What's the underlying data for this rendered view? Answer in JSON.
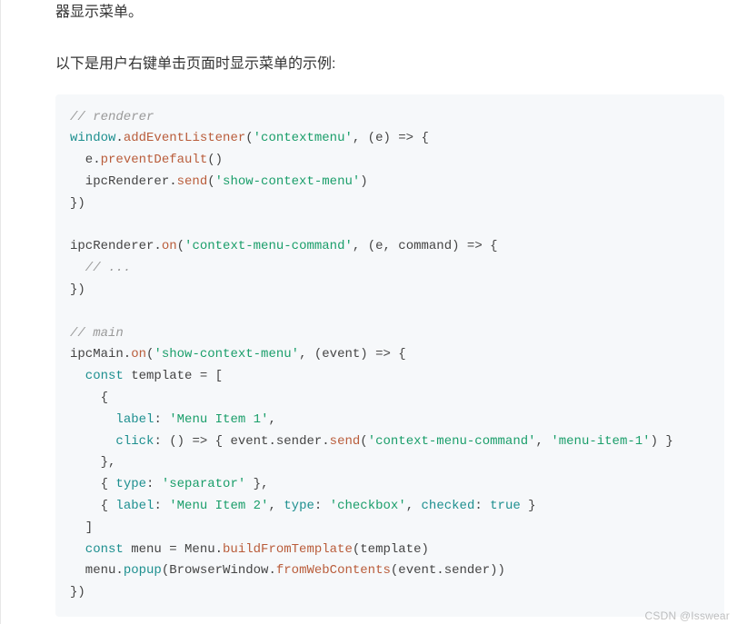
{
  "paragraphs": {
    "line1": "器显示菜单。",
    "line2": "以下是用户右键单击页面时显示菜单的示例:"
  },
  "code": {
    "c_renderer": "// renderer",
    "window": "window",
    "addEventListener": "addEventListener",
    "str_contextmenu": "'contextmenu'",
    "arrow_e": ", (e) => {",
    "e_dot": "  e.",
    "preventDefault": "preventDefault",
    "call_close": "()",
    "ipcRenderer_send_pre": "  ipcRenderer.",
    "send": "send",
    "str_show_menu": "'show-context-menu'",
    "rparen": ")",
    "brace_close_paren": "})",
    "ipcRenderer_on_pre": "ipcRenderer.",
    "on": "on",
    "str_ctx_cmd": "'context-menu-command'",
    "arrow_e_cmd": ", (e, command) => {",
    "c_ellipsis": "  // ...",
    "c_main": "// main",
    "ipcMain_on_pre": "ipcMain.",
    "arrow_event": ", (event) => {",
    "const": "  const",
    "template_eq": " template = [",
    "open_brace": "    {",
    "label": "label",
    "colon_sp": ": ",
    "str_item1": "'Menu Item 1'",
    "comma": ",",
    "click": "click",
    "click_body_pre": ": () => { event.sender.",
    "str_menu_item_1": "'menu-item-1'",
    "click_body_post": ") }",
    "close_brace_comma": "    },",
    "type": "type",
    "str_separator": "'separator'",
    "sep_line_open": "    { ",
    "sep_line_close": " },",
    "str_item2": "'Menu Item 2'",
    "str_checkbox": "'checkbox'",
    "checked": "checked",
    "true": "true",
    "item2_close": " }",
    "close_bracket": "  ]",
    "menu_eq": " menu = Menu.",
    "buildFromTemplate": "buildFromTemplate",
    "tmpl_arg": "(template)",
    "menu_dot": "  menu.",
    "popup": "popup",
    "bw_pre": "(BrowserWindow.",
    "fromWebContents": "fromWebContents",
    "bw_post": "(event.sender))"
  },
  "watermark": "CSDN @Isswear"
}
